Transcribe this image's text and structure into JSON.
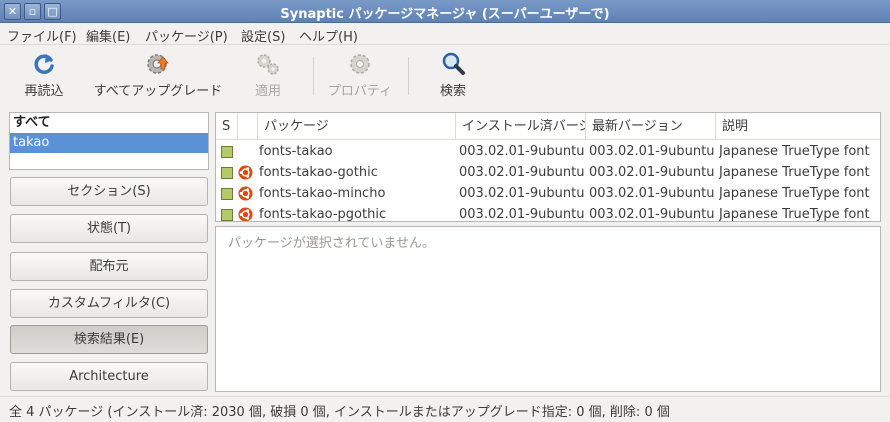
{
  "window": {
    "title": "Synaptic パッケージマネージャ  (スーパーユーザーで)",
    "close_glyph": "✕",
    "minimize_glyph": "▫",
    "maximize_glyph": "□"
  },
  "menu": {
    "file": "ファイル(F)",
    "edit": "編集(E)",
    "package": "パッケージ(P)",
    "settings": "設定(S)",
    "help": "ヘルプ(H)"
  },
  "toolbar": {
    "reload": "再読込",
    "upgrade_all": "すべてアップグレード",
    "apply": "適用",
    "properties": "プロパティ",
    "search": "検索"
  },
  "filters": {
    "items": [
      "すべて",
      "takao"
    ],
    "selected": "takao"
  },
  "sidebar_buttons": {
    "sections": "セクション(S)",
    "status": "状態(T)",
    "origin": "配布元",
    "custom_filters": "カスタムフィルタ(C)",
    "search_results": "検索結果(E)",
    "architecture": "Architecture"
  },
  "table": {
    "columns": {
      "s": "S",
      "package": "パッケージ",
      "installed_version": "インストール済バージョン",
      "latest_version": "最新バージョン",
      "description": "説明"
    },
    "rows": [
      {
        "name": "fonts-takao",
        "installed": "003.02.01-9ubuntu",
        "latest": "003.02.01-9ubuntu",
        "desc": "Japanese TrueType font",
        "ubuntu": false
      },
      {
        "name": "fonts-takao-gothic",
        "installed": "003.02.01-9ubuntu",
        "latest": "003.02.01-9ubuntu",
        "desc": "Japanese TrueType font",
        "ubuntu": true
      },
      {
        "name": "fonts-takao-mincho",
        "installed": "003.02.01-9ubuntu",
        "latest": "003.02.01-9ubuntu",
        "desc": "Japanese TrueType font",
        "ubuntu": true
      },
      {
        "name": "fonts-takao-pgothic",
        "installed": "003.02.01-9ubuntu",
        "latest": "003.02.01-9ubuntu",
        "desc": "Japanese TrueType font",
        "ubuntu": true
      }
    ]
  },
  "description_pane": {
    "empty_text": "パッケージが選択されていません。"
  },
  "statusbar": {
    "text": "全 4 パッケージ (インストール済: 2030 個, 破損 0 個, インストールまたはアップグレード指定: 0 個, 削除: 0 個"
  },
  "colors": {
    "titlebar": "#6b8cbe",
    "selection": "#5b91d6",
    "installed_status": "#b3c96a",
    "ubuntu_orange": "#dd4814"
  },
  "icons": {
    "reload": "reload-icon",
    "upgrade": "upgrade-gear-icon",
    "apply": "apply-gears-icon",
    "properties": "properties-gear-icon",
    "search": "magnifier-icon",
    "supported": "ubuntu-logo-icon"
  }
}
